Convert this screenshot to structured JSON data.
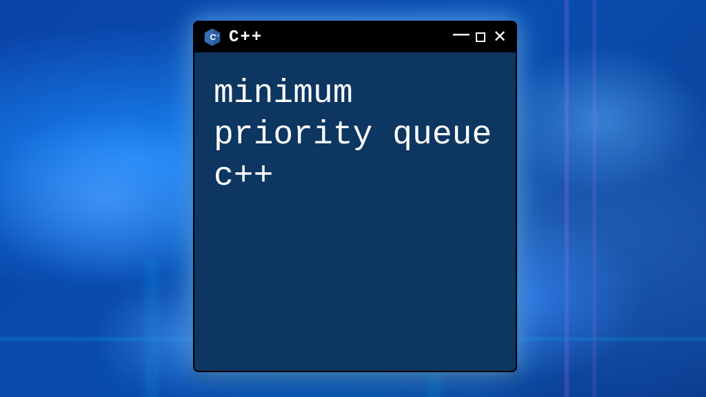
{
  "window": {
    "title": "C++",
    "content": "minimum priority queue c++",
    "icon_name": "cpp-logo"
  },
  "colors": {
    "window_bg": "#0d3660",
    "titlebar_bg": "#000000",
    "text": "#ffffff",
    "cpp_icon_blue": "#3b6db5"
  }
}
